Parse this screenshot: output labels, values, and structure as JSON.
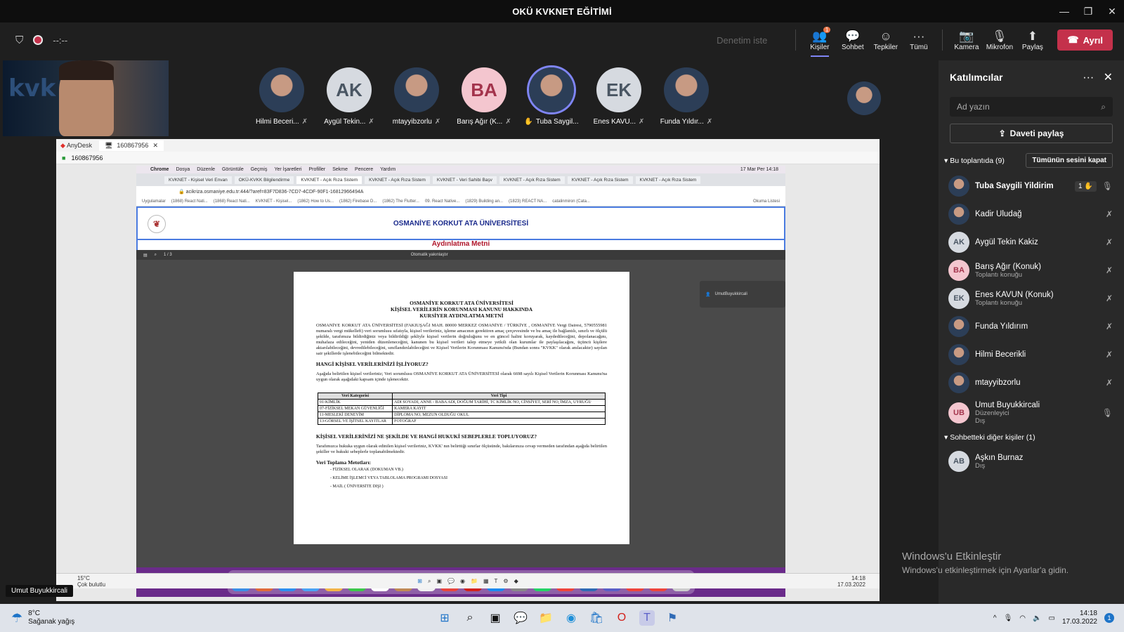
{
  "window": {
    "title": "OKÜ KVKNET EĞİTİMİ"
  },
  "meeting_toolbar": {
    "timer": "--:--",
    "request_control": "Denetim iste",
    "people": {
      "label": "Kişiler",
      "badge": "1"
    },
    "chat": "Sohbet",
    "reactions": "Tepkiler",
    "more": "Tümü",
    "camera": "Kamera",
    "mic": "Mikrofon",
    "share": "Paylaş",
    "leave": "Ayrıl"
  },
  "gallery": [
    {
      "name": "Hilmi Beceri...",
      "initials": ""
    },
    {
      "name": "Aygül Tekin...",
      "initials": "AK"
    },
    {
      "name": "mtayyibzorlu",
      "initials": ""
    },
    {
      "name": "Barış Ağır (K...",
      "initials": "BA"
    },
    {
      "name": "Tuba Saygil...",
      "initials": ""
    },
    {
      "name": "Enes KAVU...",
      "initials": "EK"
    },
    {
      "name": "Funda Yıldır...",
      "initials": ""
    }
  ],
  "panel": {
    "title": "Katılımcılar",
    "search_placeholder": "Ad yazın",
    "share_invite": "Daveti paylaş",
    "in_meeting": "Bu toplantıda (9)",
    "mute_all": "Tümünün sesini kapat",
    "participants": [
      {
        "name": "Tuba Saygili Yildirim",
        "sub": "",
        "initials": "",
        "hand": "1"
      },
      {
        "name": "Kadir Uludağ",
        "sub": "",
        "initials": ""
      },
      {
        "name": "Aygül Tekin Kakiz",
        "sub": "",
        "initials": "AK"
      },
      {
        "name": "Barış Ağır (Konuk)",
        "sub": "Toplantı konuğu",
        "initials": "BA"
      },
      {
        "name": "Enes KAVUN (Konuk)",
        "sub": "Toplantı konuğu",
        "initials": "EK"
      },
      {
        "name": "Funda Yıldırım",
        "sub": "",
        "initials": ""
      },
      {
        "name": "Hilmi Becerikli",
        "sub": "",
        "initials": ""
      },
      {
        "name": "mtayyibzorlu",
        "sub": "",
        "initials": ""
      },
      {
        "name": "Umut Buyukkircali",
        "sub": "Düzenleyici",
        "sub2": "Dış",
        "initials": "UB"
      }
    ],
    "others_section": "Sohbetteki diğer kişiler (1)",
    "others": [
      {
        "name": "Aşkın Burnaz",
        "sub": "Dış",
        "initials": "AB"
      }
    ]
  },
  "anydesk": {
    "app": "AnyDesk",
    "tab": "160867956",
    "address": "160867956",
    "mac_menu": [
      "Chrome",
      "Dosya",
      "Düzenle",
      "Görüntüle",
      "Geçmiş",
      "Yer İşaretleri",
      "Profiller",
      "Sekme",
      "Pencere",
      "Yardım"
    ],
    "mac_clock": "17 Mar Per 14:18",
    "tabs": [
      "KVKNET - Kişisel Veri Envan",
      "OKÜ-KVKK Bilgilendirme",
      "KVKNET - Açık Rıza Sistem",
      "KVKNET - Açık Rıza Sistem",
      "KVKNET - Veri Sahibi Başv",
      "KVKNET - Açık Rıza Sistem",
      "KVKNET - Açık Rıza Sistem",
      "KVKNET - Açık Rıza Sistem"
    ],
    "url": "acikriza.osmaniye.edu.tr:444/?aref=83F7D836-7CD7-4CDF-90F1-16812966494A",
    "bookmarks": [
      "Uygulamalar",
      "(1868) React Nati...",
      "(1868) React Nati...",
      "KVKNET - Kişisel...",
      "(1862) How to Us...",
      "(1862) Firebase D...",
      "(1862) The Flutter...",
      "09. React Native...",
      "(1829) Building an...",
      "(1823) REACT NA...",
      "catalinmiron (Cata..."
    ],
    "reading_list": "Okuma Listesi",
    "university": "OSMANİYE KORKUT ATA ÜNİVERSİTESİ",
    "heading": "Aydınlatma Metni",
    "pdf_page": "1 / 3",
    "pdf_zoom": "Otomatik yakınlaştır",
    "doc": {
      "h1": "OSMANİYE KORKUT ATA ÜNİVERSİTESİ",
      "h2": "KİŞİSEL VERİLERİN KORUNMASI KANUNU HAKKINDA",
      "h3": "KURSİYER AYDINLATMA METNİ",
      "p1": "OSMANİYE KORKUT ATA ÜNİVERSİTESİ (FAKIUŞAĞI MAH. 80000 MERKEZ OSMANİYE / TÜRKİYE , OSMANİYE Vergi Dairesi, 5790555981 numaralı vergi mükellefi) veri sorumlusu sıfatıyla, kişisel verileriniz, işleme amacının gerektiren amaç çerçevesinde ve bu amaç ile bağlantılı, sınırlı ve ölçülü şekilde, tarafımıza bildirdiğiniz veya bildirildiği şekliyle kişisel verilerin doğruluğunu ve en güncel halini koruyarak, kaydedileceğini, depolanacağını, muhafaza edileceğini, yeniden düzenleneceğini, kanunen bu kişisel verileri talep etmeye yetkili olan kurumlar ile paylaşılacağını, üçüncü kişilere aktarılabileceğini, devredilebileceğini, sınıflandırılabileceğini ve Kişisel Verilerin Korunması Kanunu'nda (Bundan sonra \"KVKK\" olarak anılacaktır) sayılan sair şekillerde işlenebileceğini bilmektedir.",
      "q1": "HANGİ KİŞİSEL VERİLERİNİZİ İŞLİYORUZ?",
      "p2": "Aşağıda belirtilen kişisel verileriniz; Veri sorumlusu OSMANİYE KORKUT ATA ÜNİVERSİTESİ olarak 6698 sayılı Kişisel Verilerin Korunması Kanunu'na uygun olarak aşağıdaki kapsam içinde işlenecektir.",
      "table_headers": [
        "Veri Kategorisi",
        "Veri Tipi"
      ],
      "table_rows": [
        [
          "01-KİMLİK",
          "ADI SOYADI, ANNE - BABA ADI, DOĞUM TARİHİ, TC KİMLİK NO, CİNSİYET, SERİ NO, İMZA, UYRUĞU"
        ],
        [
          "07-FİZİKSEL MEKAN GÜVENLİĞİ",
          "KAMERA KAYIT"
        ],
        [
          "11-MESLEKİ DENEYİM",
          "DİPLOMA NO, MEZUN OLDUĞU OKUL"
        ],
        [
          "13-GÖRSEL VE İŞİTSEL KAYITLAR",
          "FOTOĞRAF"
        ]
      ],
      "q2": "KİŞİSEL VERİLERİNİZİ NE ŞEKİLDE VE HANGİ HUKUKİ SEBEPLERLE TOPLUYORUZ?",
      "p3": "Tarafımızca hukuka uygun olarak edinilen kişisel verileriniz, KVKK' nın belirttiği sınırlar ölçüsünde, bakılarınıza cevap vermeden tarafından aşağıda belirtilen şekiller ve hukuki sebeplerle toplanabilmektedir.",
      "q3": "Veri Toplama Metotları:",
      "methods": [
        "- FİZİKSEL OLARAK (DOKUMAN VB.)",
        "- KELİME İŞLEMCİ VEYA TABLOLAMA PROGRAMI DOSYASI",
        "- MAİL ( ÜNİVERSİTE DIŞI )"
      ]
    },
    "remote_notice_user": "UmutBuyukkircali",
    "remote_taskbar_temp": "15°C",
    "remote_taskbar_weather": "Çok bulutlu",
    "remote_taskbar_time": "14:18",
    "remote_taskbar_date": "17.03.2022"
  },
  "name_caption": "Umut Buyukkircali",
  "activation": {
    "title": "Windows'u Etkinleştir",
    "subtitle": "Windows'u etkinleştirmek için Ayarlar'a gidin."
  },
  "taskbar": {
    "temp": "8°C",
    "weather": "Sağanak yağış",
    "time": "14:18",
    "date": "17.03.2022",
    "notif": "1"
  }
}
